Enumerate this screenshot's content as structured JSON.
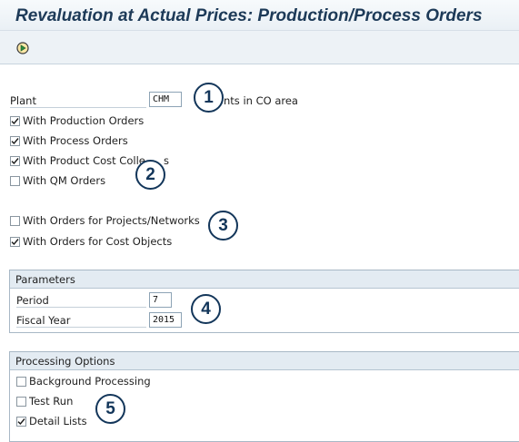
{
  "window": {
    "title": "Revaluation at Actual Prices: Production/Process Orders"
  },
  "toolbar": {
    "execute_icon": "execute-clock-icon"
  },
  "selection": {
    "plant_label": "Plant",
    "plant_value": "CHM",
    "plant_suffix": "nts in CO area",
    "with_production_orders": {
      "label": "With Production Orders",
      "checked": true
    },
    "with_process_orders": {
      "label": "With Process Orders",
      "checked": true
    },
    "with_product_cost_collectors": {
      "label": "With Product Cost Colle",
      "label_tail": "s",
      "checked": true
    },
    "with_qm_orders": {
      "label": "With QM Orders",
      "checked": false
    },
    "with_orders_projects": {
      "label": "With Orders for Projects/Networks",
      "checked": false
    },
    "with_orders_cost_objects": {
      "label": "With Orders for Cost Objects",
      "checked": true
    }
  },
  "parameters": {
    "header": "Parameters",
    "period_label": "Period",
    "period_value": "7",
    "fiscal_year_label": "Fiscal Year",
    "fiscal_year_value": "2015"
  },
  "processing_options": {
    "header": "Processing Options",
    "background_processing": {
      "label": "Background Processing",
      "checked": false
    },
    "test_run": {
      "label": "Test Run",
      "checked": false
    },
    "detail_lists": {
      "label": "Detail Lists",
      "checked": true
    }
  },
  "callouts": [
    "1",
    "2",
    "3",
    "4",
    "5"
  ],
  "colors": {
    "title": "#1d3a58",
    "callout": "#13365a",
    "group_header_bg": "#e3ebf2",
    "toolbar_bg": "#edf2f6"
  }
}
